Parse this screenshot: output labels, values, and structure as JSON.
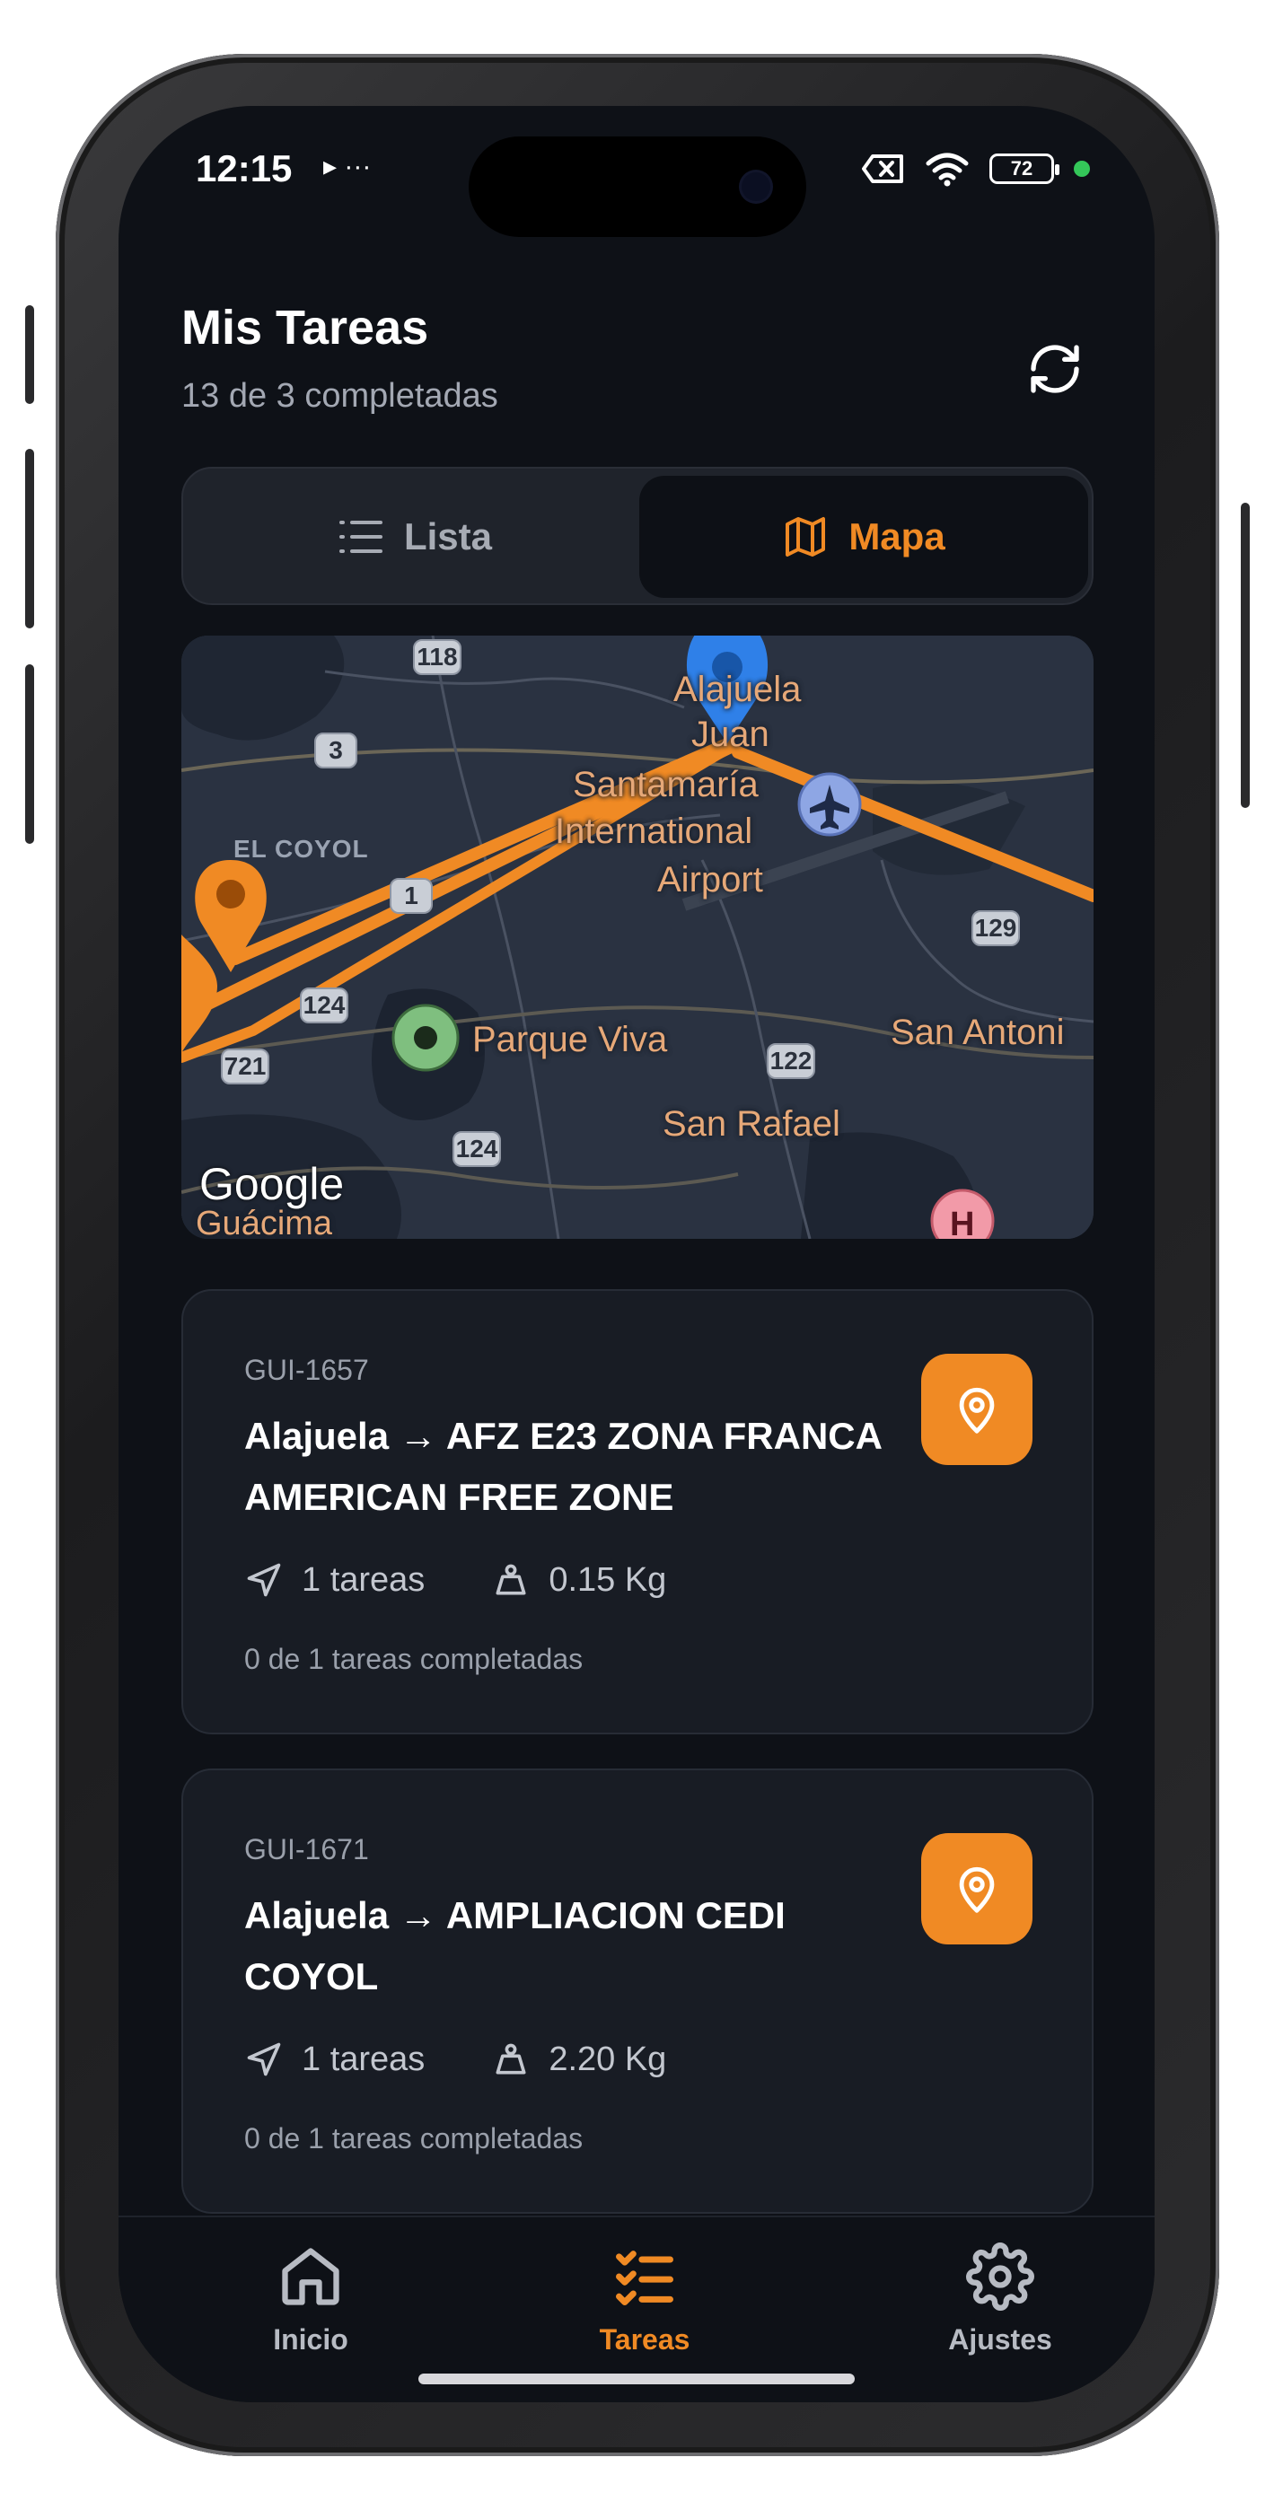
{
  "status_bar": {
    "time": "12:15",
    "left_icons": "▸ ···",
    "battery": "72",
    "icons": [
      "battery-x-icon",
      "wifi-icon",
      "battery-icon",
      "privacy-dot"
    ]
  },
  "header": {
    "title": "Mis Tareas",
    "subtitle": "13 de 3 completadas",
    "refresh_icon": "refresh-icon"
  },
  "view_toggle": {
    "tabs": [
      {
        "label": "Lista",
        "icon": "list-icon",
        "active": false
      },
      {
        "label": "Mapa",
        "icon": "map-icon",
        "active": true
      }
    ]
  },
  "map": {
    "labels": {
      "alajuela": "Alajuela",
      "juan": "Juan",
      "airport_line1": "Santamaría",
      "airport_line2": "International",
      "airport_line3": "Airport",
      "el_coyol": "EL COYOL",
      "parque_viva": "Parque Viva",
      "san_antonio": "San Antoni",
      "san_rafael": "San Rafael",
      "guacima": "Guácima"
    },
    "shields": [
      "118",
      "3",
      "1",
      "124",
      "721",
      "124",
      "122",
      "129"
    ],
    "attribution": "Google",
    "colors": {
      "route": "#f08a24",
      "blue_pin": "#2f80e8",
      "green_pin": "#7fbf7f",
      "background": "#293140"
    }
  },
  "tasks": [
    {
      "code": "GUI-1657",
      "route": "Alajuela → AFZ E23 ZONA FRANCA AMERICAN FREE ZONE",
      "tasks_count": "1 tareas",
      "weight": "0.15 Kg",
      "progress": "0 de 1 tareas completadas"
    },
    {
      "code": "GUI-1671",
      "route": "Alajuela → AMPLIACION CEDI COYOL",
      "tasks_count": "1 tareas",
      "weight": "2.20 Kg",
      "progress": "0 de 1 tareas completadas"
    }
  ],
  "bottom_nav": {
    "items": [
      {
        "label": "Inicio",
        "icon": "home-icon",
        "active": false
      },
      {
        "label": "Tareas",
        "icon": "tasks-icon",
        "active": true
      },
      {
        "label": "Ajustes",
        "icon": "gear-icon",
        "active": false
      }
    ]
  },
  "theme": {
    "accent": "#f08a24",
    "background": "#0e1117",
    "card": "#181c24"
  }
}
